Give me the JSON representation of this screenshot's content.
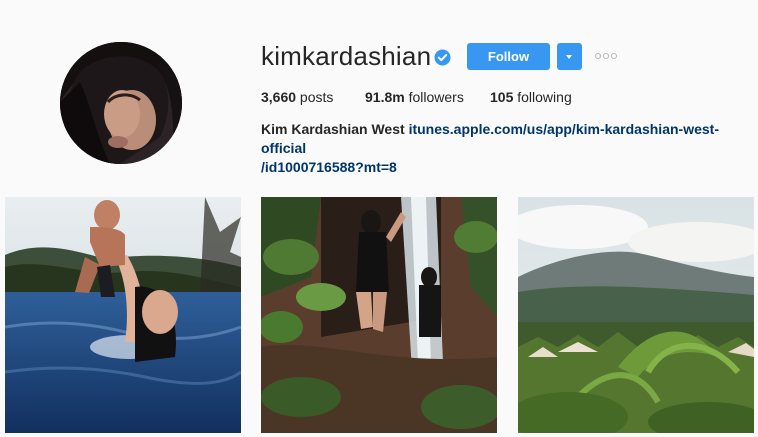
{
  "profile": {
    "username": "kimkardashian",
    "verified_icon": "verified-badge-icon",
    "follow_label": "Follow",
    "dropdown_icon": "chevron-down-icon",
    "options_icon": "more-options-icon",
    "stats": {
      "posts_count": "3,660",
      "posts_label": " posts",
      "followers_count": "91.8m",
      "followers_label": " followers",
      "following_count": "105",
      "following_label": " following"
    },
    "bio": {
      "name": "Kim Kardashian West",
      "link_line1": "itunes.apple.com/us/app/kim-kardashian-west-official",
      "link_line2": "/id1000716588?mt=8"
    }
  },
  "colors": {
    "accent": "#3897f0",
    "link": "#003569",
    "verified": "#3897f0",
    "background": "#fafafa"
  }
}
